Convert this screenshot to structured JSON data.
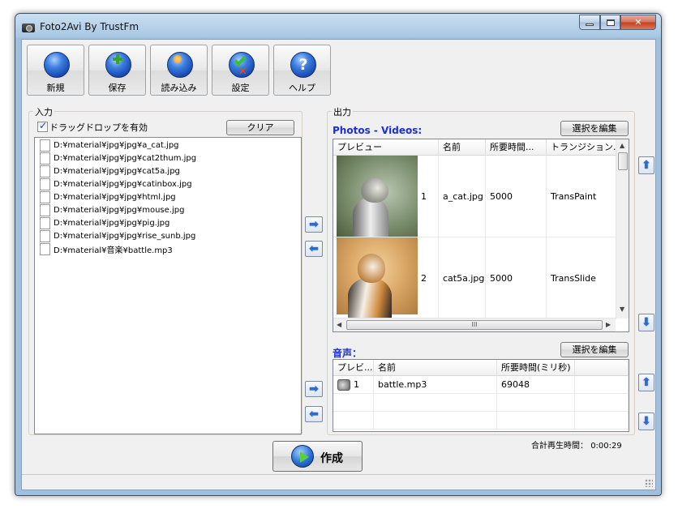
{
  "window": {
    "title": "Foto2Avi By TrustFm"
  },
  "toolbar": {
    "new_label": "新規",
    "save_label": "保存",
    "load_label": "読み込み",
    "settings_label": "設定",
    "help_label": "ヘルプ",
    "help_glyph": "?"
  },
  "input": {
    "group_title": "入力",
    "dragdrop_label": "ドラッグドロップを有効",
    "dragdrop_checked": true,
    "clear_label": "クリア",
    "files": [
      "D:¥material¥jpg¥jpg¥a_cat.jpg",
      "D:¥material¥jpg¥jpg¥cat2thum.jpg",
      "D:¥material¥jpg¥jpg¥cat5a.jpg",
      "D:¥material¥jpg¥jpg¥catinbox.jpg",
      "D:¥material¥jpg¥jpg¥html.jpg",
      "D:¥material¥jpg¥jpg¥mouse.jpg",
      "D:¥material¥jpg¥jpg¥pig.jpg",
      "D:¥material¥jpg¥jpg¥rise_sunb.jpg",
      "D:¥material¥音楽¥battle.mp3"
    ]
  },
  "output": {
    "group_title": "出力",
    "photos_title": "Photos - Videos:",
    "edit_selection_label": "選択を編集",
    "photo_columns": [
      "プレビュー",
      "名前",
      "所要時間...",
      "トランジション..."
    ],
    "photos": [
      {
        "index": "1",
        "name": "a_cat.jpg",
        "duration": "5000",
        "transition": "TransPaint"
      },
      {
        "index": "2",
        "name": "cat5a.jpg",
        "duration": "5000",
        "transition": "TransSlide"
      }
    ],
    "hscroll_grip": "III",
    "audio_title": "音声：",
    "audio_edit_label": "選択を編集",
    "audio_columns": [
      "プレビ...",
      "名前",
      "所要時間(ミリ秒)",
      ""
    ],
    "audio": [
      {
        "index": "1",
        "name": "battle.mp3",
        "duration": "69048"
      }
    ],
    "total_label": "合計再生時間：",
    "total_value": "0:00:29"
  },
  "actions": {
    "make_label": "作成"
  }
}
